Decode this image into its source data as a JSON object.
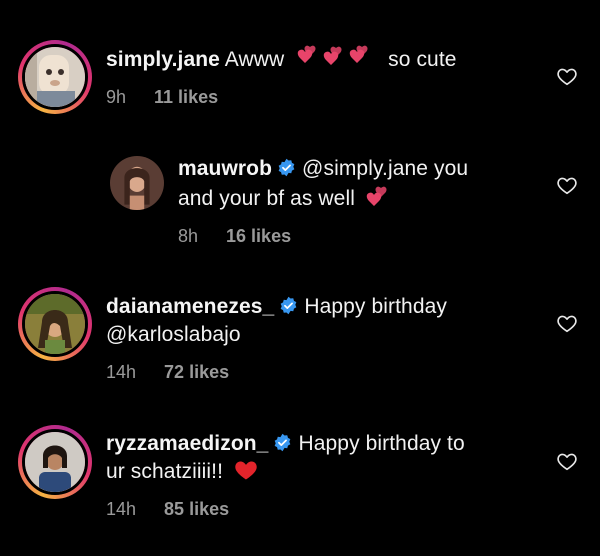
{
  "comments": [
    {
      "username": "simply.jane",
      "text_before": "Awww",
      "emojis": "hearts",
      "text_after": "so cute",
      "time": "9h",
      "likes": "11 likes",
      "verified": false
    },
    {
      "username": "mauwrob",
      "text_line1": "@simply.jane you",
      "text_line2": "and your bf as well",
      "time": "8h",
      "likes": "16 likes",
      "verified": true
    },
    {
      "username": "daianamenezes_",
      "text_line1": "Happy birthday",
      "text_line2": "@karloslabajo",
      "time": "14h",
      "likes": "72 likes",
      "verified": true
    },
    {
      "username": "ryzzamaedizon_",
      "text_line1": "Happy birthday to",
      "text_line2": "ur schatziiii!!",
      "time": "14h",
      "likes": "85 likes",
      "verified": true
    }
  ],
  "colors": {
    "background": "#000000",
    "text": "#f2f2f2",
    "meta": "#9a9a9a",
    "verified": "#3897f0",
    "heart_emoji": "#e8446a",
    "red_heart": "#e3242b"
  },
  "icons": {
    "like": "heart-outline-icon",
    "verified": "verified-badge-icon"
  }
}
